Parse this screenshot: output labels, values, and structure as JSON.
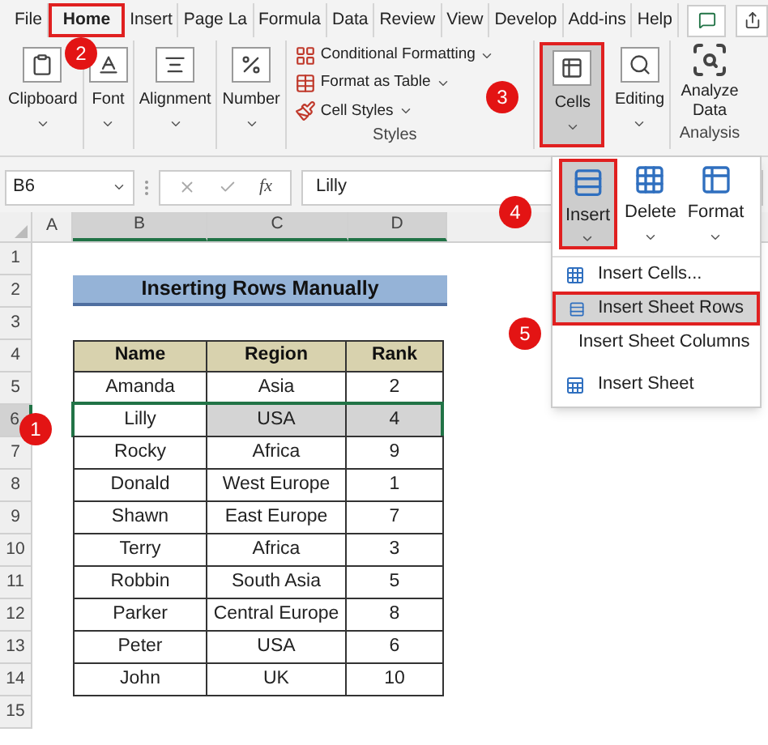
{
  "tabs": [
    {
      "label": "File",
      "selected": false
    },
    {
      "label": "Home",
      "selected": true
    },
    {
      "label": "Insert",
      "selected": false
    },
    {
      "label": "Page La",
      "selected": false
    },
    {
      "label": "Formula",
      "selected": false
    },
    {
      "label": "Data",
      "selected": false
    },
    {
      "label": "Review",
      "selected": false
    },
    {
      "label": "View",
      "selected": false
    },
    {
      "label": "Develop",
      "selected": false
    },
    {
      "label": "Add-ins",
      "selected": false
    },
    {
      "label": "Help",
      "selected": false
    }
  ],
  "ribbon": [
    {
      "kind": "button",
      "label": "Clipboard",
      "expanded": false
    },
    {
      "kind": "button",
      "label": "Font",
      "expanded": false
    },
    {
      "kind": "button",
      "label": "Alignment",
      "expanded": false
    },
    {
      "kind": "button",
      "label": "Number",
      "expanded": false
    },
    {
      "kind": "styles",
      "items": [
        "Conditional Formatting",
        "Format as Table",
        "Cell Styles"
      ],
      "group_label": "Styles"
    },
    {
      "kind": "button",
      "label": "Cells",
      "expanded": true
    },
    {
      "kind": "button",
      "label": "Editing",
      "expanded": false
    },
    {
      "kind": "large",
      "label": "Analyze Data",
      "group_label": "Analysis"
    }
  ],
  "formula_bar": {
    "name_box": "B6",
    "function_label": "fx",
    "value": "Lilly"
  },
  "cells_menu": {
    "buttons": [
      {
        "label": "Insert",
        "selected": true
      },
      {
        "label": "Delete",
        "selected": false
      },
      {
        "label": "Format",
        "selected": false
      }
    ],
    "items": [
      {
        "label": "Insert Cells...",
        "selected": false
      },
      {
        "label": "Insert Sheet Rows",
        "selected": true
      },
      {
        "label": "Insert Sheet Columns",
        "selected": false
      },
      {
        "label": "Insert Sheet",
        "selected": false
      }
    ]
  },
  "sheet": {
    "columns": [
      {
        "label": "A",
        "selected": false
      },
      {
        "label": "B",
        "selected": true
      },
      {
        "label": "C",
        "selected": true
      },
      {
        "label": "D",
        "selected": true
      }
    ],
    "row_numbers": [
      {
        "label": "1",
        "selected": false
      },
      {
        "label": "2",
        "selected": false
      },
      {
        "label": "3",
        "selected": false
      },
      {
        "label": "4",
        "selected": false
      },
      {
        "label": "5",
        "selected": false
      },
      {
        "label": "6",
        "selected": true
      },
      {
        "label": "7",
        "selected": false
      },
      {
        "label": "8",
        "selected": false
      },
      {
        "label": "9",
        "selected": false
      },
      {
        "label": "10",
        "selected": false
      },
      {
        "label": "11",
        "selected": false
      },
      {
        "label": "12",
        "selected": false
      },
      {
        "label": "13",
        "selected": false
      },
      {
        "label": "14",
        "selected": false
      },
      {
        "label": "15",
        "selected": false
      }
    ],
    "title": "Inserting Rows Manually",
    "table_header": [
      "Name",
      "Region",
      "Rank"
    ],
    "rows": [
      {
        "cells": [
          "",
          "Amanda",
          "Asia",
          "2"
        ],
        "selected": false
      },
      {
        "cells": [
          "",
          "Lilly",
          "USA",
          "4"
        ],
        "selected": true
      },
      {
        "cells": [
          "",
          "Rocky",
          "Africa",
          "9"
        ],
        "selected": false
      },
      {
        "cells": [
          "",
          "Donald",
          "West Europe",
          "1"
        ],
        "selected": false
      },
      {
        "cells": [
          "",
          "Shawn",
          "East Europe",
          "7"
        ],
        "selected": false
      },
      {
        "cells": [
          "",
          "Terry",
          "Africa",
          "3"
        ],
        "selected": false
      },
      {
        "cells": [
          "",
          "Robbin",
          "South Asia",
          "5"
        ],
        "selected": false
      },
      {
        "cells": [
          "",
          "Parker",
          "Central Europe",
          "8"
        ],
        "selected": false
      },
      {
        "cells": [
          "",
          "Peter",
          "USA",
          "6"
        ],
        "selected": false
      },
      {
        "cells": [
          "",
          "John",
          "UK",
          "10"
        ],
        "selected": false
      }
    ]
  },
  "callouts": [
    "1",
    "2",
    "3",
    "4",
    "5"
  ]
}
